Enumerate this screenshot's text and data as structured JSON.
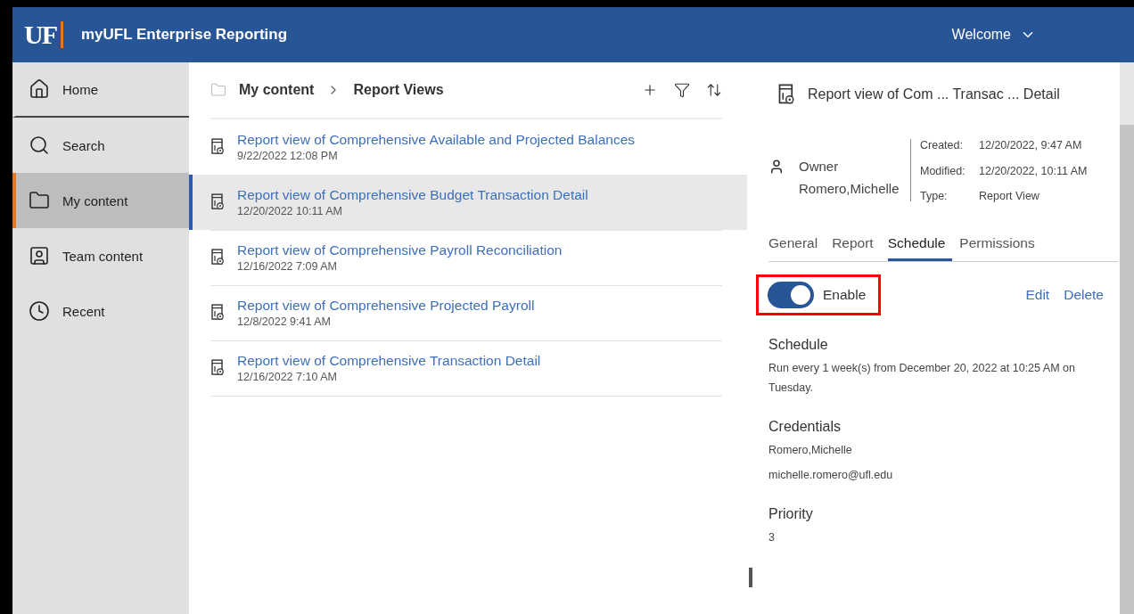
{
  "header": {
    "logo": "UF",
    "title": "myUFL Enterprise Reporting",
    "welcome": "Welcome"
  },
  "sidebar": {
    "items": [
      {
        "label": "Home",
        "kind": "home",
        "selected": false
      },
      {
        "label": "Search",
        "kind": "search",
        "selected": false
      },
      {
        "label": "My content",
        "kind": "folder",
        "selected": true
      },
      {
        "label": "Team content",
        "kind": "team",
        "selected": false
      },
      {
        "label": "Recent",
        "kind": "recent",
        "selected": false
      }
    ]
  },
  "breadcrumb": [
    "My content",
    "Report Views"
  ],
  "items": [
    {
      "title": "Report view of Comprehensive Available and Projected Balances",
      "date": "9/22/2022 12:08 PM",
      "selected": false
    },
    {
      "title": "Report view of Comprehensive Budget Transaction Detail",
      "date": "12/20/2022 10:11 AM",
      "selected": true
    },
    {
      "title": "Report view of Comprehensive Payroll Reconciliation",
      "date": "12/16/2022 7:09 AM",
      "selected": false
    },
    {
      "title": "Report view of Comprehensive Projected Payroll",
      "date": "12/8/2022 9:41 AM",
      "selected": false
    },
    {
      "title": "Report view of Comprehensive Transaction Detail",
      "date": "12/16/2022 7:10 AM",
      "selected": false
    }
  ],
  "details": {
    "title": "Report view of Com ... Transac ... Detail",
    "owner_label": "Owner",
    "owner": "Romero,Michelle",
    "meta": [
      {
        "label": "Created:",
        "value": "12/20/2022, 9:47 AM"
      },
      {
        "label": "Modified:",
        "value": "12/20/2022, 10:11 AM"
      },
      {
        "label": "Type:",
        "value": "Report View"
      }
    ],
    "tabs": [
      {
        "label": "General",
        "selected": false
      },
      {
        "label": "Report",
        "selected": false
      },
      {
        "label": "Schedule",
        "selected": true
      },
      {
        "label": "Permissions",
        "selected": false
      }
    ],
    "enable": {
      "label": "Enable",
      "on": true,
      "highlighted": true
    },
    "actions": [
      "Edit",
      "Delete"
    ],
    "sections": [
      {
        "heading": "Schedule",
        "lines": [
          "Run every 1 week(s) from December 20, 2022 at 10:25 AM on Tuesday."
        ]
      },
      {
        "heading": "Credentials",
        "lines": [
          "Romero,Michelle",
          "michelle.romero@ufl.edu"
        ]
      },
      {
        "heading": "Priority",
        "lines": [
          "3"
        ]
      }
    ]
  }
}
